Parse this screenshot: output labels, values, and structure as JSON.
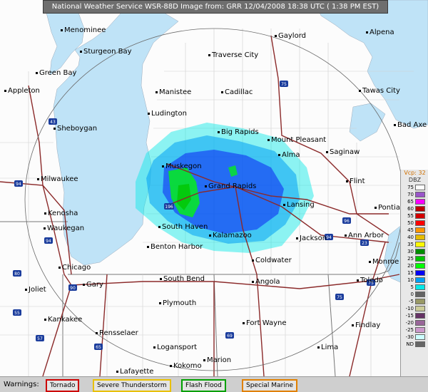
{
  "title": "National Weather Service WSR-88D Image from: GRR 12/04/2008 18:38 UTC ( 1:38 PM EST)",
  "cities": [
    {
      "name": "Menominee"
    },
    {
      "name": "Sturgeon Bay"
    },
    {
      "name": "Green Bay"
    },
    {
      "name": "Appleton"
    },
    {
      "name": "Sheboygan"
    },
    {
      "name": "Milwaukee"
    },
    {
      "name": "Kenosha"
    },
    {
      "name": "Waukegan"
    },
    {
      "name": "Chicago"
    },
    {
      "name": "Joliet"
    },
    {
      "name": "Gary"
    },
    {
      "name": "Kankakee"
    },
    {
      "name": "Rensselaer"
    },
    {
      "name": "Logansport"
    },
    {
      "name": "Lafayette"
    },
    {
      "name": "Kokomo"
    },
    {
      "name": "Marion"
    },
    {
      "name": "Plymouth"
    },
    {
      "name": "South Bend"
    },
    {
      "name": "Benton Harbor"
    },
    {
      "name": "South Haven"
    },
    {
      "name": "Kalamazoo"
    },
    {
      "name": "Coldwater"
    },
    {
      "name": "Angola"
    },
    {
      "name": "Fort Wayne"
    },
    {
      "name": "Lima"
    },
    {
      "name": "Findlay"
    },
    {
      "name": "Toledo"
    },
    {
      "name": "Monroe"
    },
    {
      "name": "Ann Arbor"
    },
    {
      "name": "Jackson"
    },
    {
      "name": "Lansing"
    },
    {
      "name": "Grand Rapids"
    },
    {
      "name": "Muskegon"
    },
    {
      "name": "Big Rapids"
    },
    {
      "name": "Mount Pleasant"
    },
    {
      "name": "Alma"
    },
    {
      "name": "Saginaw"
    },
    {
      "name": "Flint"
    },
    {
      "name": "Pontiac"
    },
    {
      "name": "Bad Axe"
    },
    {
      "name": "Tawas City"
    },
    {
      "name": "Alpena"
    },
    {
      "name": "Gaylord"
    },
    {
      "name": "Traverse City"
    },
    {
      "name": "Cadillac"
    },
    {
      "name": "Manistee"
    },
    {
      "name": "Ludington"
    }
  ],
  "highway_shields": [
    "43",
    "94",
    "94",
    "80",
    "90",
    "55",
    "57",
    "65",
    "69",
    "75",
    "196",
    "94",
    "96",
    "23",
    "75",
    "75"
  ],
  "legend": {
    "title": "Vcp: 32",
    "unit": "DBZ",
    "levels": [
      {
        "label": "75",
        "color": "#fefefe"
      },
      {
        "label": "70",
        "color": "#9955c9"
      },
      {
        "label": "65",
        "color": "#f800fd"
      },
      {
        "label": "60",
        "color": "#bc0000"
      },
      {
        "label": "55",
        "color": "#d40000"
      },
      {
        "label": "50",
        "color": "#fd0000"
      },
      {
        "label": "45",
        "color": "#fd9500"
      },
      {
        "label": "40",
        "color": "#e5bc00"
      },
      {
        "label": "35",
        "color": "#fdf802"
      },
      {
        "label": "30",
        "color": "#008e00"
      },
      {
        "label": "25",
        "color": "#01c501"
      },
      {
        "label": "20",
        "color": "#02fd02"
      },
      {
        "label": "15",
        "color": "#0300f4"
      },
      {
        "label": "10",
        "color": "#019ff4"
      },
      {
        "label": "5",
        "color": "#04e9e7"
      },
      {
        "label": "0",
        "color": "#646464"
      },
      {
        "label": "-5",
        "color": "#999966"
      },
      {
        "label": "-10",
        "color": "#cccc99"
      },
      {
        "label": "-15",
        "color": "#663366"
      },
      {
        "label": "-20",
        "color": "#996699"
      },
      {
        "label": "-25",
        "color": "#cc99cc"
      },
      {
        "label": "-30",
        "color": "#ccffff"
      },
      {
        "label": "ND",
        "color": "#666666"
      }
    ]
  },
  "warnings": {
    "label": "Warnings:",
    "items": [
      {
        "label": "Tornado",
        "color": "#cc0000"
      },
      {
        "label": "Severe Thunderstorm",
        "color": "#e8c000"
      },
      {
        "label": "Flash Flood",
        "color": "#00a000"
      },
      {
        "label": "Special Marine",
        "color": "#e08000"
      }
    ]
  },
  "colors": {
    "water": "#bfe3f7",
    "land": "#fcfcfc",
    "roads": "#8b2a2a",
    "boundaries": "#777777",
    "range_ring": "#6a6a6a"
  }
}
